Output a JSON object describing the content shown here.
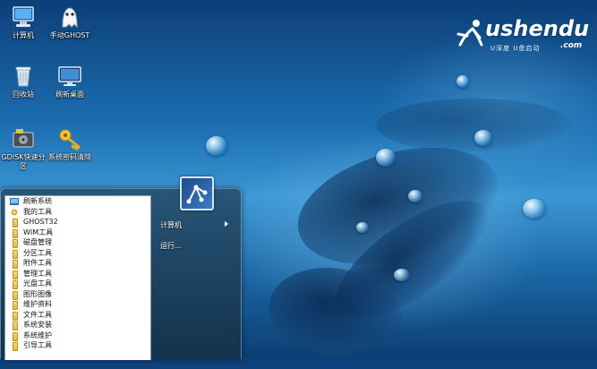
{
  "desktop": {
    "icons": [
      {
        "label": "计算机",
        "icon": "computer-icon"
      },
      {
        "label": "手动GHOST",
        "icon": "ghost-icon"
      },
      {
        "label": "回收站",
        "icon": "recycle-bin-icon"
      },
      {
        "label": "刷新桌面",
        "icon": "refresh-desktop-icon"
      },
      {
        "label": "GDISK快速分区",
        "icon": "gdisk-icon"
      },
      {
        "label": "系统密码清除",
        "icon": "key-icon"
      }
    ]
  },
  "logo": {
    "text": "ushendu",
    "suffix": ".com",
    "subtitle": "U深度 U盘启动"
  },
  "start_menu": {
    "programs": [
      {
        "label": "刷新系统",
        "icon": "refresh-icon"
      },
      {
        "label": "我的工具",
        "icon": "tools-icon"
      },
      {
        "label": "GHOST32",
        "icon": "folder-icon"
      },
      {
        "label": "WIM工具",
        "icon": "folder-icon"
      },
      {
        "label": "磁盘管理",
        "icon": "folder-icon"
      },
      {
        "label": "分区工具",
        "icon": "folder-icon"
      },
      {
        "label": "附件工具",
        "icon": "folder-icon"
      },
      {
        "label": "管理工具",
        "icon": "folder-icon"
      },
      {
        "label": "光盘工具",
        "icon": "folder-icon"
      },
      {
        "label": "图形图像",
        "icon": "folder-icon"
      },
      {
        "label": "维护资料",
        "icon": "folder-icon"
      },
      {
        "label": "文件工具",
        "icon": "folder-icon"
      },
      {
        "label": "系统安装",
        "icon": "folder-icon"
      },
      {
        "label": "系统维护",
        "icon": "folder-icon"
      },
      {
        "label": "引导工具",
        "icon": "folder-icon"
      }
    ],
    "right": [
      {
        "label": "计算机",
        "has_submenu": true
      },
      {
        "label": "运行..."
      }
    ]
  },
  "colors": {
    "accent": "#1c6fb2",
    "menu_bg": "#1e4a6e"
  }
}
